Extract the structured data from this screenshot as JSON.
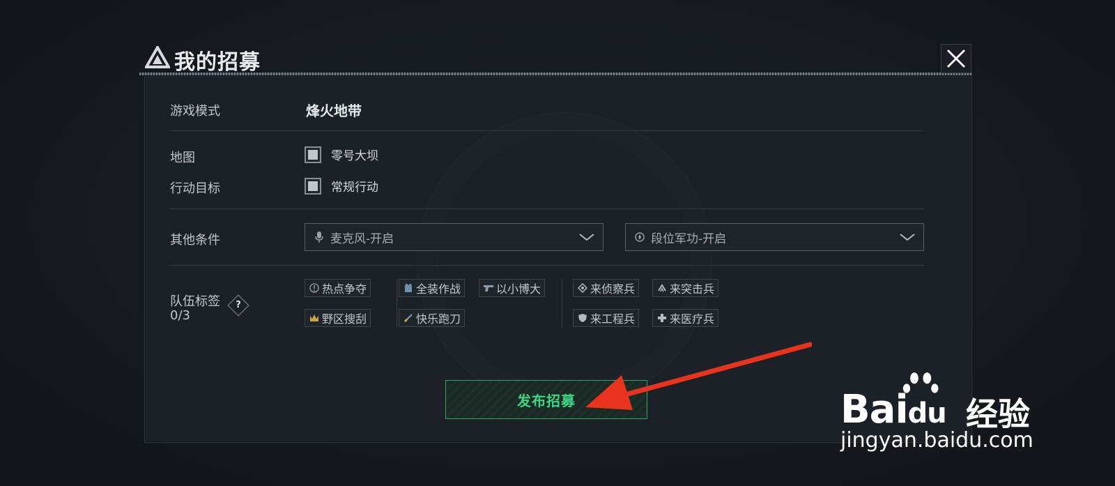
{
  "dialog": {
    "title": "我的招募"
  },
  "form": {
    "game_mode_label": "游戏模式",
    "game_mode_value": "烽火地带",
    "map_label": "地图",
    "map_value": "零号大坝",
    "objective_label": "行动目标",
    "objective_value": "常规行动",
    "other_label": "其他条件",
    "mic_select": "麦克风-开启",
    "rank_select": "段位军功-开启",
    "team_tags_label": "队伍标签",
    "team_tags_count": "0/3",
    "help_glyph": "?"
  },
  "tags": {
    "group1": [
      "热点争夺",
      "野区搜刮"
    ],
    "group2": [
      "全装作战",
      "以小博大",
      "快乐跑刀"
    ],
    "group3": [
      "来侦察兵",
      "来突击兵",
      "来工程兵",
      "来医疗兵"
    ]
  },
  "actions": {
    "publish": "发布招募"
  },
  "watermark": {
    "brand": "Bai",
    "brand2": "du",
    "cn": "经验",
    "url": "jingyan.baidu.com"
  },
  "colors": {
    "accent_green": "#3fd586",
    "arrow_red": "#e8331f"
  }
}
